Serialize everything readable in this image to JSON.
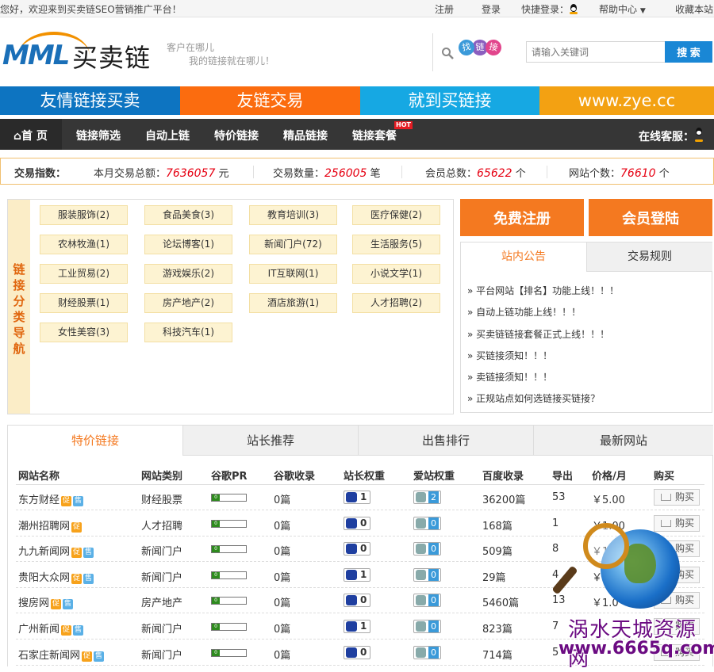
{
  "topbar": {
    "welcome": "您好，欢迎来到买卖链SEO营销推广平台！",
    "register": "注册",
    "login": "登录",
    "quick_login": "快捷登录：",
    "help": "帮助中心",
    "bookmark": "收藏本站"
  },
  "header": {
    "logo_text": "买卖链",
    "logo_mark": "MML",
    "slogan_1": "客户在哪儿",
    "slogan_2": "我的链接就在哪儿！",
    "find_links": [
      "找",
      "链",
      "接"
    ],
    "search_placeholder": "请输入关键词",
    "search_button": "搜 索"
  },
  "banner": [
    {
      "text": "友情链接买卖",
      "color": "#0d74c1"
    },
    {
      "text": "友链交易",
      "color": "#fb6c0f"
    },
    {
      "text": "就到买链接",
      "color": "#16a8e3"
    },
    {
      "text": "www.zye.cc",
      "color": "#f3a112"
    }
  ],
  "nav": {
    "home": "首 页",
    "items": [
      "链接筛选",
      "自动上链",
      "特价链接",
      "精品链接",
      "链接套餐"
    ],
    "hot": "HOT",
    "online_service": "在线客服："
  },
  "stats": {
    "label": "交易指数：",
    "total_amount_label": "本月交易总额：",
    "total_amount": "7636057",
    "total_amount_unit": "元",
    "trade_count_label": "交易数量：",
    "trade_count": "256005",
    "trade_count_unit": "笔",
    "members_label": "会员总数：",
    "members": "65622",
    "members_unit": "个",
    "sites_label": "网站个数：",
    "sites": "76610",
    "sites_unit": "个"
  },
  "category": {
    "title": "链接分类导航",
    "items": [
      "服装服饰(2)",
      "食品美食(3)",
      "教育培训(3)",
      "医疗保健(2)",
      "农林牧渔(1)",
      "论坛博客(1)",
      "新闻门户(72)",
      "生活服务(5)",
      "工业贸易(2)",
      "游戏娱乐(2)",
      "IT互联网(1)",
      "小说文学(1)",
      "财经股票(1)",
      "房产地产(2)",
      "酒店旅游(1)",
      "人才招聘(2)",
      "女性美容(3)",
      "科技汽车(1)"
    ]
  },
  "side": {
    "register_button": "免费注册",
    "login_button": "会员登陆",
    "tab_notice": "站内公告",
    "tab_rules": "交易规则",
    "notices": [
      "» 平台网站【排名】功能上线！！！",
      "» 自动上链功能上线！！！",
      "» 买卖链链接套餐正式上线！！！",
      "» 买链接须知！！！",
      "» 卖链接须知！！！",
      "» 正规站点如何选链接买链接？"
    ]
  },
  "listing": {
    "tabs": [
      "特价链接",
      "站长推荐",
      "出售排行",
      "最新网站"
    ],
    "headers": [
      "网站名称",
      "网站类别",
      "谷歌PR",
      "谷歌收录",
      "站长权重",
      "爱站权重",
      "百度收录",
      "导出",
      "价格/月",
      "购买"
    ],
    "buy_label": "购买",
    "tag_promo": "促",
    "tag_sell": "售",
    "rows": [
      {
        "name": "东方财经",
        "category": "财经股票",
        "pr": "0",
        "google": "0篇",
        "zz": "1",
        "az": "2",
        "baidu": "36200篇",
        "out": "53",
        "price": "￥5.00"
      },
      {
        "name": "潮州招聘网",
        "category": "人才招聘",
        "pr": "0",
        "google": "0篇",
        "zz": "0",
        "az": "0",
        "baidu": "168篇",
        "out": "1",
        "price": "￥1.00"
      },
      {
        "name": "九九新闻网",
        "category": "新闻门户",
        "pr": "0",
        "google": "0篇",
        "zz": "0",
        "az": "0",
        "baidu": "509篇",
        "out": "8",
        "price": "￥1.0"
      },
      {
        "name": "贵阳大众网",
        "category": "新闻门户",
        "pr": "0",
        "google": "0篇",
        "zz": "1",
        "az": "0",
        "baidu": "29篇",
        "out": "4",
        "price": "￥1.0"
      },
      {
        "name": "搜房网",
        "category": "房产地产",
        "pr": "0",
        "google": "0篇",
        "zz": "0",
        "az": "0",
        "baidu": "5460篇",
        "out": "13",
        "price": "￥1.0"
      },
      {
        "name": "广州新闻",
        "category": "新闻门户",
        "pr": "0",
        "google": "0篇",
        "zz": "1",
        "az": "0",
        "baidu": "823篇",
        "out": "7",
        "price": ""
      },
      {
        "name": "石家庄新闻网",
        "category": "新闻门户",
        "pr": "0",
        "google": "0篇",
        "zz": "0",
        "az": "0",
        "baidu": "714篇",
        "out": "5",
        "price": ""
      }
    ]
  },
  "watermark": {
    "line1": "涡水天城资源网",
    "line2": "www.6665q.com"
  }
}
